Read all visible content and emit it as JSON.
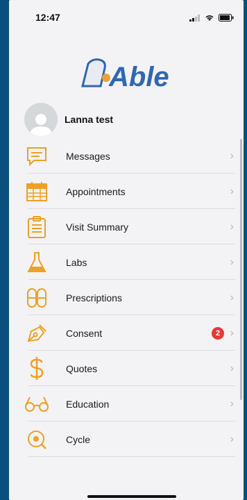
{
  "status": {
    "time": "12:47"
  },
  "profile": {
    "name": "Lanna test"
  },
  "menu": [
    {
      "label": "Messages",
      "icon": "message-icon"
    },
    {
      "label": "Appointments",
      "icon": "calendar-icon"
    },
    {
      "label": "Visit Summary",
      "icon": "clipboard-icon"
    },
    {
      "label": "Labs",
      "icon": "flask-icon"
    },
    {
      "label": "Prescriptions",
      "icon": "pills-icon"
    },
    {
      "label": "Consent",
      "icon": "pen-icon",
      "badge": "2"
    },
    {
      "label": "Quotes",
      "icon": "dollar-icon"
    },
    {
      "label": "Education",
      "icon": "glasses-icon"
    },
    {
      "label": "Cycle",
      "icon": "cycle-icon"
    }
  ],
  "colors": {
    "accent": "#f0a023",
    "badge": "#e53935",
    "logo": "#2f67b2"
  }
}
